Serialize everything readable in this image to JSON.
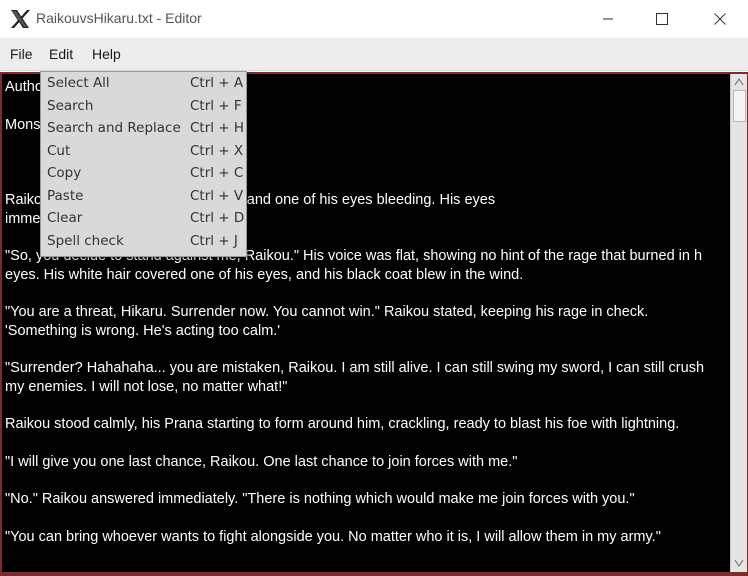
{
  "window": {
    "title": "RaikouvsHikaru.txt - Editor",
    "app_icon": "x-logo-icon",
    "controls": [
      "minimize-icon",
      "maximize-icon",
      "close-icon"
    ]
  },
  "menubar": {
    "items": [
      {
        "label": "File"
      },
      {
        "label": "Edit"
      },
      {
        "label": "Help"
      }
    ]
  },
  "edit_menu": {
    "items": [
      {
        "label": "Select All",
        "shortcut": "Ctrl + A"
      },
      {
        "label": "Search",
        "shortcut": "Ctrl + F"
      },
      {
        "label": "Search and Replace",
        "shortcut": "Ctrl + H"
      },
      {
        "label": "Cut",
        "shortcut": "Ctrl + X"
      },
      {
        "label": "Copy",
        "shortcut": "Ctrl + C"
      },
      {
        "label": "Paste",
        "shortcut": "Ctrl + V"
      },
      {
        "label": "Clear",
        "shortcut": "Ctrl + D"
      },
      {
        "label": "Spell check",
        "shortcut": "Ctrl + J"
      }
    ]
  },
  "editor": {
    "lines": [
      "Autho",
      "Mons",
      "Raiko                                                      s black hair drenched in blood, and one of his eyes bleeding. His eyes",
      "imme                                                        his 'throne'.",
      "\"So, you decide to stand against me, Raikou.\" His voice was flat, showing no hint of the rage that burned in h",
      "eyes. His white hair covered one of his eyes, and his black coat blew in the wind.",
      "\"You are a threat, Hikaru. Surrender now. You cannot win.\" Raikou stated, keeping his rage in check.",
      "'Something is wrong. He's acting too calm.'",
      "\"Surrender? Hahahaha... you are mistaken, Raikou. I am still alive. I can still swing my sword, I can still crush",
      "my enemies. I will not lose, no matter what!\"",
      "Raikou stood calmly, his Prana starting to form around him, crackling, ready to blast his foe with lightning.",
      "\"I will give you one last chance, Raikou. One last chance to join forces with me.\"",
      "\"No.\" Raikou answered immediately. \"There is nothing which would make me join forces with you.\"",
      "\"You can bring whoever wants to fight alongside you. No matter who it is, I will allow them in my army.\""
    ]
  },
  "colors": {
    "editor_background": "#000000",
    "editor_text": "#ffffff",
    "editor_border": "#7d2b2b",
    "menu_background": "#d9d9d9"
  }
}
